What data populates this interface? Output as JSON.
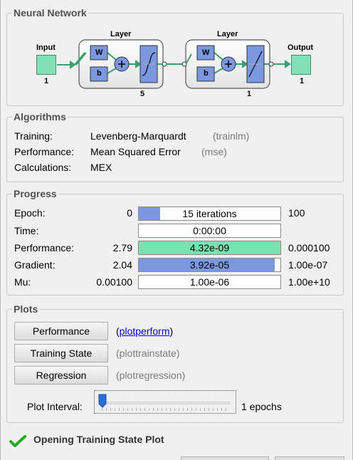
{
  "network": {
    "title": "Neural Network",
    "input_label": "Input",
    "input_size": "1",
    "output_label": "Output",
    "output_size": "1",
    "layers": [
      {
        "title": "Layer",
        "w": "W",
        "b": "b",
        "size": "5",
        "transfer": "tansig"
      },
      {
        "title": "Layer",
        "w": "W",
        "b": "b",
        "size": "1",
        "transfer": "purelin"
      }
    ]
  },
  "algorithms": {
    "title": "Algorithms",
    "rows": [
      {
        "label": "Training:",
        "value": "Levenberg-Marquardt",
        "fn": "(trainlm)"
      },
      {
        "label": "Performance:",
        "value": "Mean Squared Error",
        "fn": "(mse)"
      },
      {
        "label": "Calculations:",
        "value": "MEX",
        "fn": ""
      }
    ]
  },
  "progress": {
    "title": "Progress",
    "rows": [
      {
        "label": "Epoch:",
        "start": "0",
        "bar_text": "15 iterations",
        "end": "100",
        "fill_fraction": 0.15,
        "fill_color": "#7b97e0"
      },
      {
        "label": "Time:",
        "start": "",
        "bar_text": "0:00:00",
        "end": "",
        "fill_fraction": 0,
        "fill_color": "#ffffff"
      },
      {
        "label": "Performance:",
        "start": "2.79",
        "bar_text": "4.32e-09",
        "end": "0.000100",
        "fill_fraction": 1.0,
        "fill_color": "#7de0b0"
      },
      {
        "label": "Gradient:",
        "start": "2.04",
        "bar_text": "3.92e-05",
        "end": "1.00e-07",
        "fill_fraction": 0.96,
        "fill_color": "#7b97e0"
      },
      {
        "label": "Mu:",
        "start": "0.00100",
        "bar_text": "1.00e-06",
        "end": "1.00e+10",
        "fill_fraction": 0,
        "fill_color": "#ffffff"
      }
    ]
  },
  "plots": {
    "title": "Plots",
    "buttons": [
      {
        "label": "Performance",
        "fn": "(plotperform)"
      },
      {
        "label": "Training State",
        "fn": "(plottrainstate)"
      },
      {
        "label": "Regression",
        "fn": "(plotregression)"
      }
    ],
    "interval_label": "Plot Interval:",
    "interval_value": "1 epochs"
  },
  "status": {
    "icon": "checkmark-icon",
    "text": "Opening Training State Plot",
    "color": "#22aa22"
  }
}
